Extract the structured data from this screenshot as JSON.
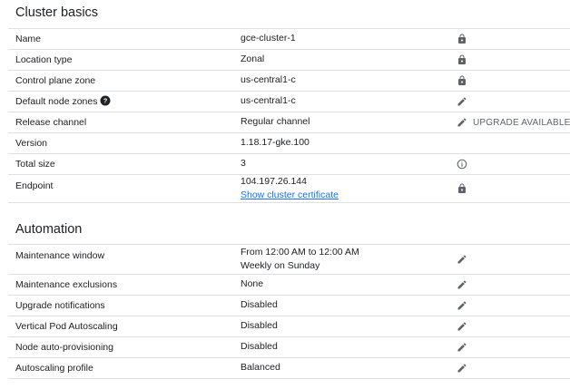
{
  "cluster_basics": {
    "title": "Cluster basics",
    "rows": [
      {
        "label": "Name",
        "value": "gce-cluster-1",
        "icon": "lock-icon"
      },
      {
        "label": "Location type",
        "value": "Zonal",
        "icon": "lock-icon"
      },
      {
        "label": "Control plane zone",
        "value": "us-central1-c",
        "icon": "lock-icon"
      },
      {
        "label": "Default node zones",
        "value": "us-central1-c",
        "icon": "edit-icon",
        "help_icon": "help-icon"
      },
      {
        "label": "Release channel",
        "value": "Regular channel",
        "icon": "edit-icon",
        "action_label": "UPGRADE AVAILABLE"
      },
      {
        "label": "Version",
        "value": "1.18.17-gke.100"
      },
      {
        "label": "Total size",
        "value": "3",
        "icon": "info-icon"
      },
      {
        "label": "Endpoint",
        "value": "104.197.26.144",
        "link": "Show cluster certificate",
        "icon": "lock-icon"
      }
    ]
  },
  "automation": {
    "title": "Automation",
    "rows": [
      {
        "label": "Maintenance window",
        "value": "From 12:00 AM to 12:00 AM",
        "value2": "Weekly on Sunday",
        "icon": "edit-icon"
      },
      {
        "label": "Maintenance exclusions",
        "value": "None",
        "icon": "edit-icon"
      },
      {
        "label": "Upgrade notifications",
        "value": "Disabled",
        "icon": "edit-icon"
      },
      {
        "label": "Vertical Pod Autoscaling",
        "value": "Disabled",
        "icon": "edit-icon"
      },
      {
        "label": "Node auto-provisioning",
        "value": "Disabled",
        "icon": "edit-icon"
      },
      {
        "label": "Autoscaling profile",
        "value": "Balanced",
        "icon": "edit-icon"
      }
    ]
  },
  "colors": {
    "text": "#202124",
    "icon": "#5f6368",
    "link": "#1a73e8",
    "divider": "#e0e0e0"
  }
}
